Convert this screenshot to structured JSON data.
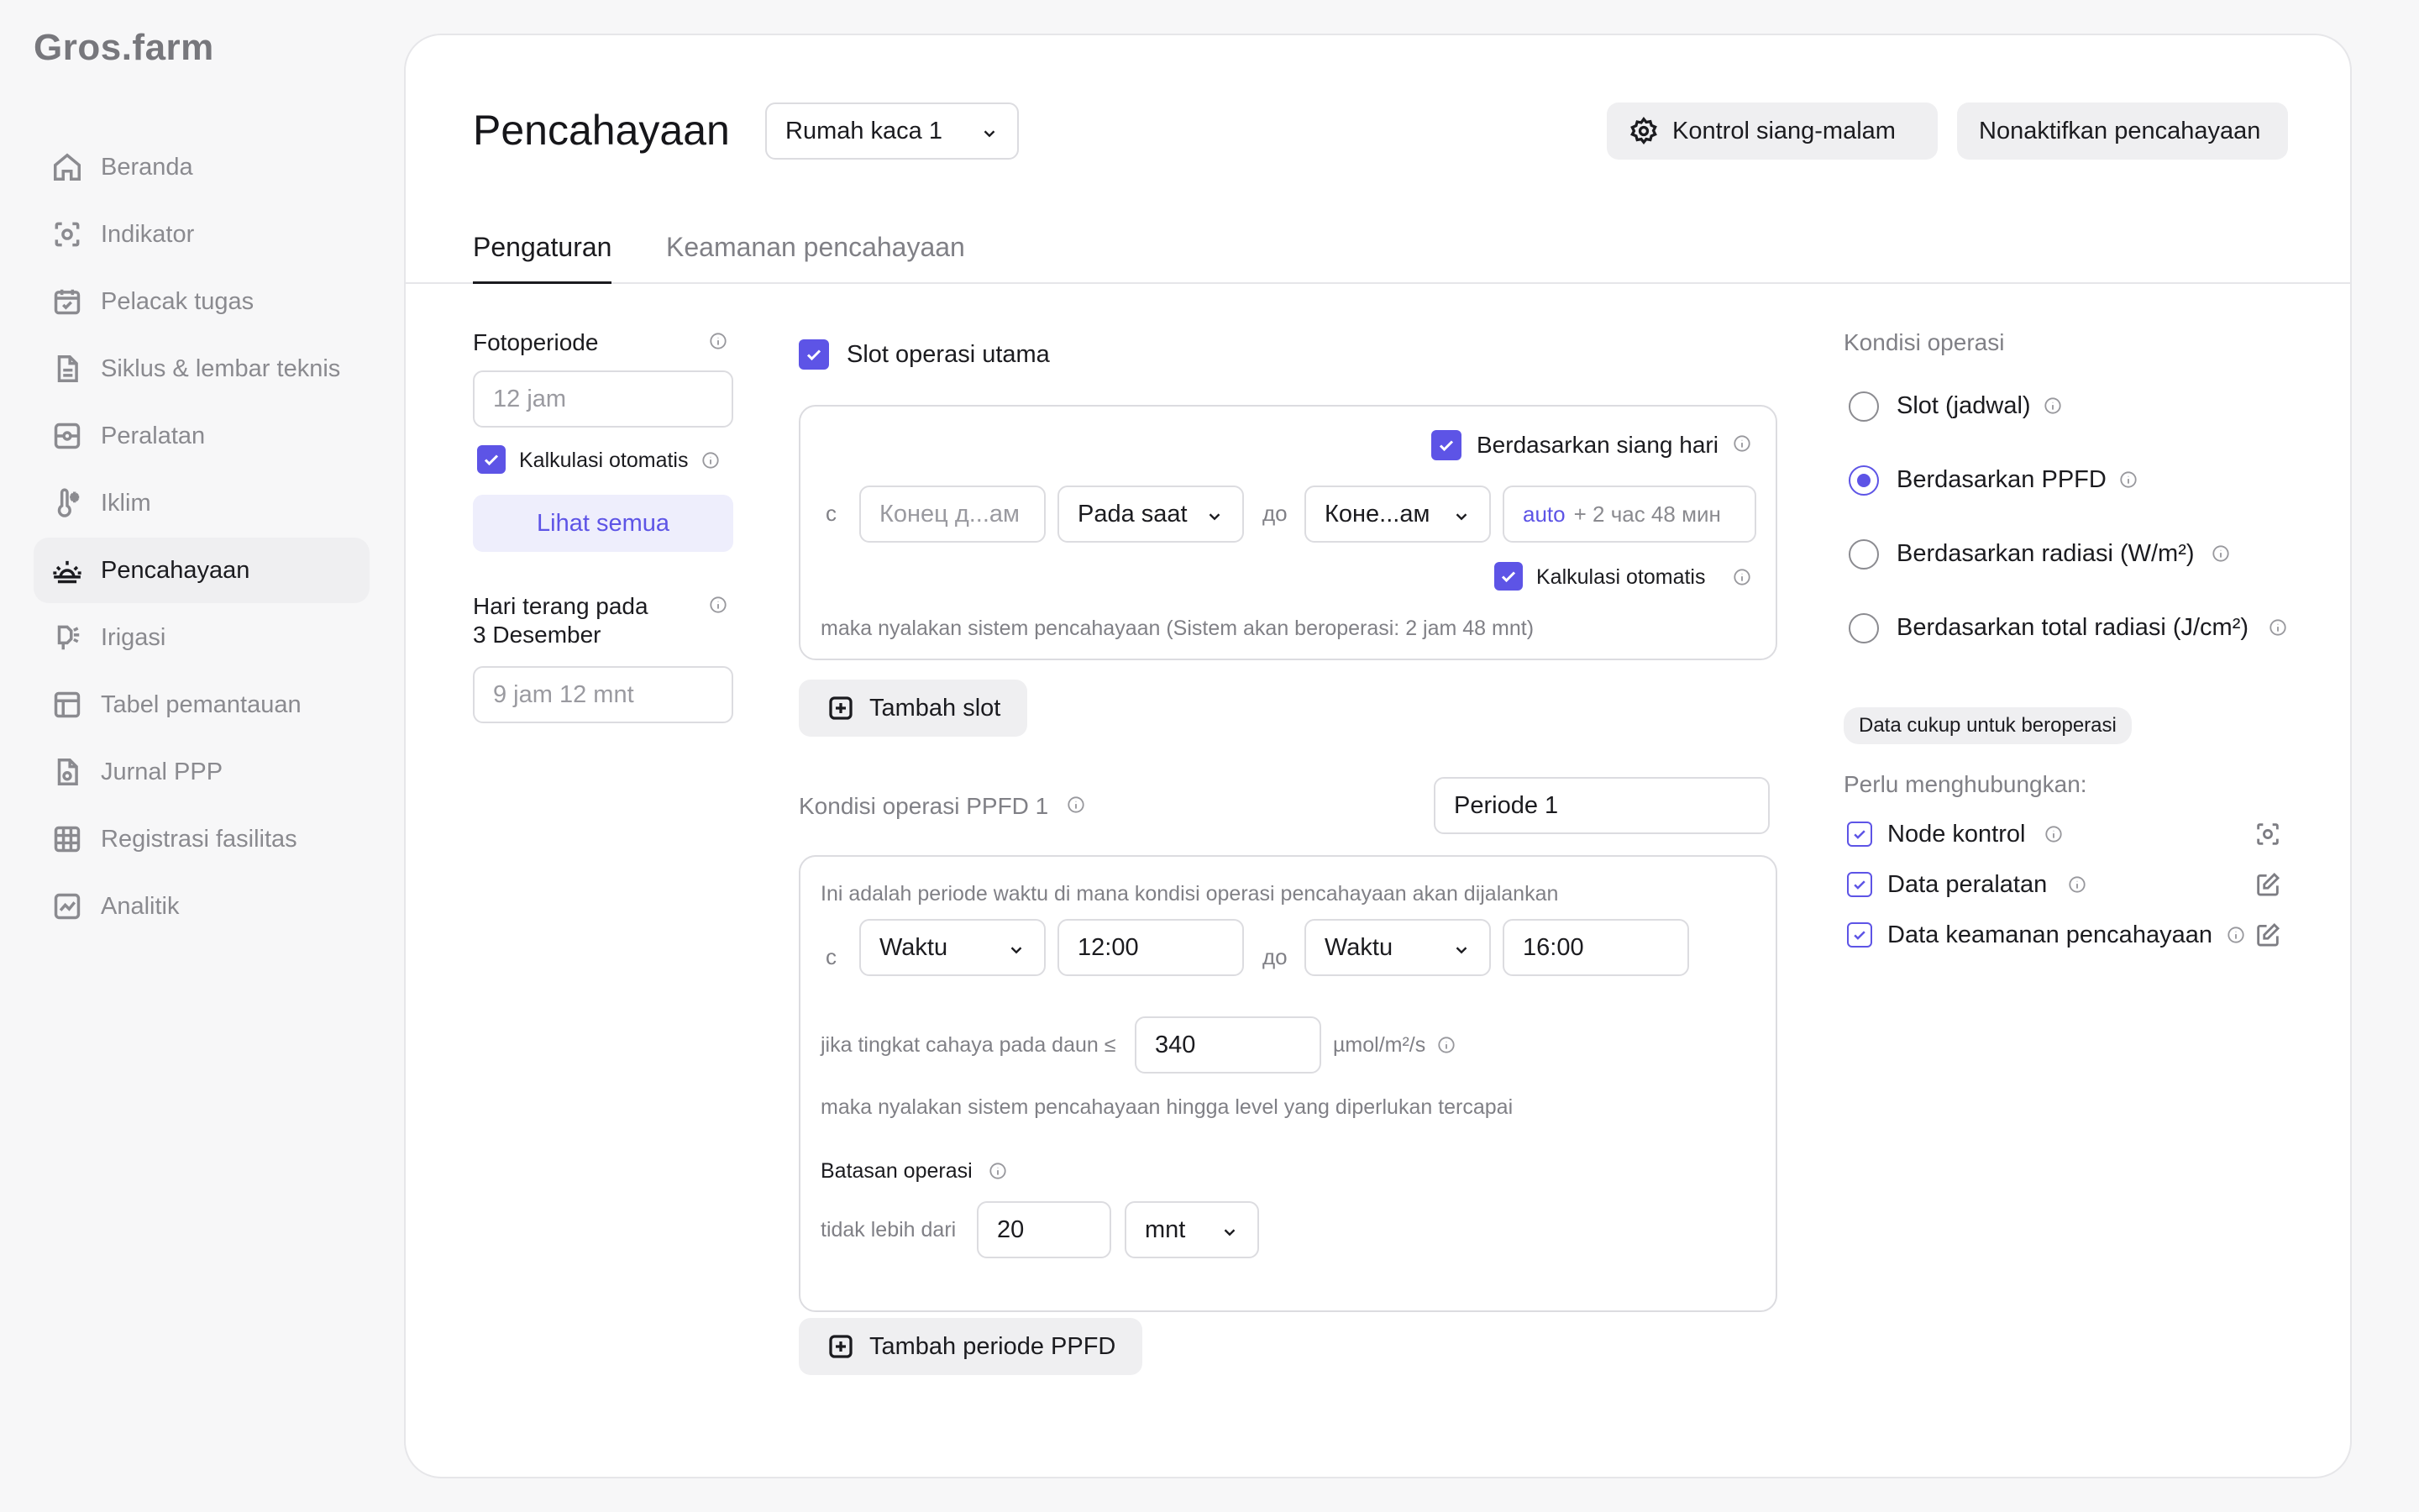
{
  "app": {
    "logo": "Gros.farm"
  },
  "sidebar": {
    "items": [
      {
        "label": "Beranda",
        "icon": "home-icon"
      },
      {
        "label": "Indikator",
        "icon": "sensor-icon"
      },
      {
        "label": "Pelacak tugas",
        "icon": "calendar-check-icon"
      },
      {
        "label": "Siklus & lembar teknis",
        "icon": "document-icon"
      },
      {
        "label": "Peralatan",
        "icon": "equipment-icon"
      },
      {
        "label": "Iklim",
        "icon": "thermometer-icon"
      },
      {
        "label": "Pencahayaan",
        "icon": "sunrise-icon",
        "active": true
      },
      {
        "label": "Irigasi",
        "icon": "sprinkler-icon"
      },
      {
        "label": "Tabel pemantauan",
        "icon": "table-icon"
      },
      {
        "label": "Jurnal PPP",
        "icon": "gear-document-icon"
      },
      {
        "label": "Registrasi fasilitas",
        "icon": "grid-icon"
      },
      {
        "label": "Analitik",
        "icon": "chart-icon"
      }
    ]
  },
  "header": {
    "title": "Pencahayaan",
    "greenhouse_select": "Rumah kaca 1",
    "daynight_button": "Kontrol siang-malam",
    "disable_button": "Nonaktifkan pencahayaan"
  },
  "tabs": [
    {
      "label": "Pengaturan",
      "active": true
    },
    {
      "label": "Keamanan pencahayaan",
      "active": false
    }
  ],
  "left": {
    "photoperiod_label": "Fotoperiode",
    "photoperiod_placeholder": "12 jam",
    "auto_calc_label": "Kalkulasi otomatis",
    "see_all_button": "Lihat semua",
    "daylight_label_line1": "Hari terang pada",
    "daylight_label_line2": "3 Desember",
    "daylight_placeholder": "9 jam 12 mnt"
  },
  "slot": {
    "main_slot_label": "Slot operasi utama",
    "daylight_based_label": "Berdasarkan siang hari",
    "from_label": "с",
    "from_placeholder": "Конец д...ам",
    "mode_select": "Pada saat",
    "to_label": "до",
    "to_select": "Коне...ам",
    "auto_prefix": "auto",
    "auto_value": "+ 2 час 48 мин",
    "auto_calc_label": "Kalkulasi otomatis",
    "description": "maka nyalakan sistem pencahayaan (Sistem akan beroperasi: 2 jam 48 mnt)",
    "add_slot_button": "Tambah slot"
  },
  "ppfd": {
    "condition_label": "Kondisi operasi PPFD 1",
    "period_select": "Periode 1",
    "intro": "Ini adalah periode waktu di mana kondisi operasi pencahayaan akan dijalankan",
    "from_label": "с",
    "from_select": "Waktu",
    "from_time": "12:00",
    "to_label": "до",
    "to_select": "Waktu",
    "to_time": "16:00",
    "threshold_label": "jika tingkat cahaya pada daun ≤",
    "threshold_value": "340",
    "unit": "µmol/m²/s",
    "result_text": "maka nyalakan sistem pencahayaan hingga level yang diperlukan tercapai",
    "limit_label": "Batasan operasi",
    "limit_prefix": "tidak lebih dari",
    "limit_value": "20",
    "limit_unit": "mnt",
    "add_period_button": "Tambah periode PPFD"
  },
  "right": {
    "title": "Kondisi operasi",
    "options": [
      {
        "label": "Slot (jadwal)",
        "selected": false
      },
      {
        "label": "Berdasarkan PPFD",
        "selected": true
      },
      {
        "label": "Berdasarkan radiasi (W/m²)",
        "selected": false
      },
      {
        "label": "Berdasarkan total radiasi (J/cm²)",
        "selected": false
      }
    ],
    "status_badge": "Data cukup untuk beroperasi",
    "connect_label": "Perlu menghubungkan:",
    "connections": [
      {
        "label": "Node kontrol",
        "icon": "sensor-icon"
      },
      {
        "label": "Data peralatan",
        "icon": "edit-icon"
      },
      {
        "label": "Data keamanan pencahayaan",
        "icon": "edit-icon"
      }
    ]
  },
  "colors": {
    "accent": "#5d54e6",
    "accent_light": "#eeeefc",
    "border": "#dcdce0",
    "muted_text": "#808086"
  }
}
